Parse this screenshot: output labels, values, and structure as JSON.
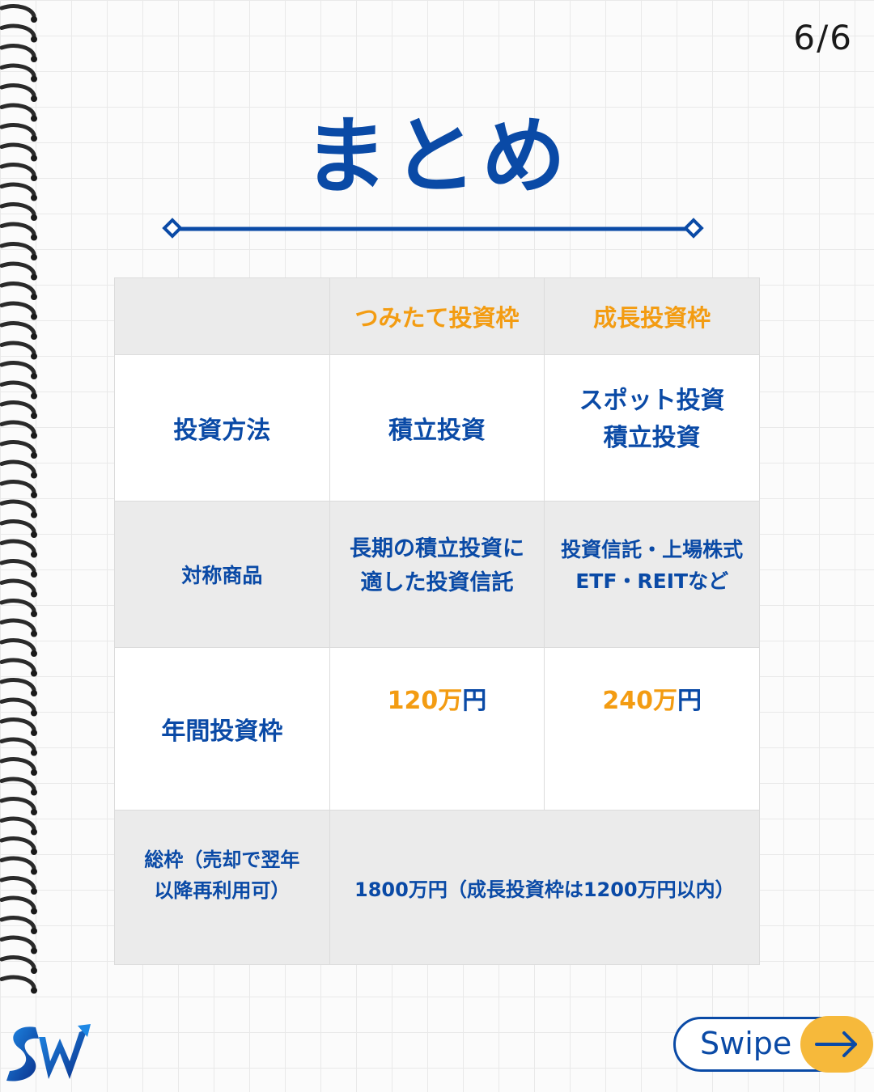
{
  "page_number": "6/6",
  "title": "まとめ",
  "table": {
    "headers": [
      "",
      "つみたて投資枠",
      "成長投資枠"
    ],
    "rows": [
      {
        "label": "投資方法",
        "tsumitate": "積立投資",
        "growth_line1": "スポット投資",
        "growth_line2": "積立投資"
      },
      {
        "label": "対称商品",
        "tsumitate_line1": "長期の積立投資に",
        "tsumitate_line2": "適した投資信託",
        "growth_line1": "投資信託・上場株式",
        "growth_line2": "ETF・REITなど"
      },
      {
        "label": "年間投資枠",
        "tsumitate_amount": "120万",
        "tsumitate_unit": "円",
        "growth_amount": "240万",
        "growth_unit": "円"
      },
      {
        "label_line1": "総枠（売却で翌年",
        "label_line2": "以降再利用可）",
        "value": "1800万円（成長投資枠は1200万円以内）"
      }
    ]
  },
  "swipe_label": "Swipe",
  "colors": {
    "primary": "#0a4aa6",
    "accent": "#f39c12"
  },
  "logo_icon": "sw-logo-icon",
  "arrow_icon": "arrow-right-icon"
}
